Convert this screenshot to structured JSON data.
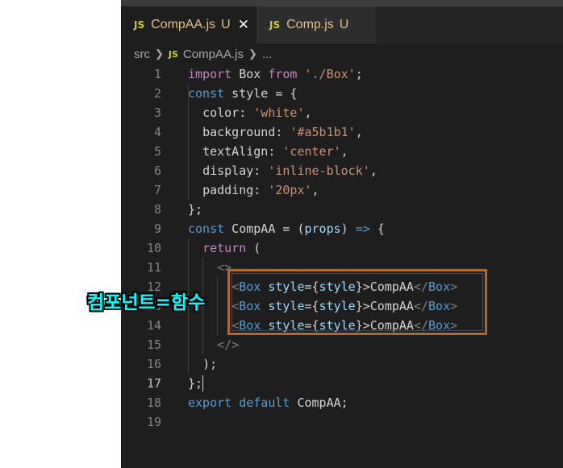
{
  "tabs": [
    {
      "icon": "JS",
      "name": "CompAA.js",
      "flag": "U",
      "close": "✕"
    },
    {
      "icon": "JS",
      "name": "Comp.js",
      "flag": "U"
    }
  ],
  "breadcrumb": {
    "folder": "src",
    "icon": "JS",
    "file": "CompAA.js",
    "more": "..."
  },
  "line_numbers": [
    "1",
    "2",
    "3",
    "4",
    "5",
    "6",
    "7",
    "8",
    "9",
    "10",
    "11",
    "12",
    "13",
    "14",
    "15",
    "16",
    "17",
    "18",
    "19"
  ],
  "code": {
    "l1": {
      "import": "import",
      "name": " Box ",
      "from": "from",
      "path": "'./Box'",
      "semi": ";"
    },
    "l2": {
      "const": "const",
      "rest": " style = {"
    },
    "l3": {
      "prop": "color",
      "colon": ": ",
      "val": "'white'",
      "comma": ","
    },
    "l4": {
      "prop": "background",
      "colon": ": ",
      "val": "'#a5b1b1'",
      "comma": ","
    },
    "l5": {
      "prop": "textAlign",
      "colon": ": ",
      "val": "'center'",
      "comma": ","
    },
    "l6": {
      "prop": "display",
      "colon": ": ",
      "val": "'inline-block'",
      "comma": ","
    },
    "l7": {
      "prop": "padding",
      "colon": ": ",
      "val": "'20px'",
      "comma": ","
    },
    "l8": {
      "text": "};"
    },
    "l9": {
      "const": "const",
      "name": " CompAA = (",
      "param": "props",
      "close": ") ",
      "arrow": "=>",
      "brace": " {"
    },
    "l10": {
      "kw": "return",
      "rest": " ("
    },
    "l11": {
      "frag": "<>"
    },
    "l12": {
      "open": "<",
      "tag": "Box",
      "attr": " style",
      "eq": "={",
      "expr": "style",
      "close1": "}>",
      "text": "CompAA",
      "open2": "</",
      "tag2": "Box",
      "close2": ">"
    },
    "l13": {
      "open": "<",
      "tag": "Box",
      "attr": " style",
      "eq": "={",
      "expr": "style",
      "close1": "}>",
      "text": "CompAA",
      "open2": "</",
      "tag2": "Box",
      "close2": ">"
    },
    "l14": {
      "open": "<",
      "tag": "Box",
      "attr": " style",
      "eq": "={",
      "expr": "style",
      "close1": "}>",
      "text": "CompAA",
      "open2": "</",
      "tag2": "Box",
      "close2": ">"
    },
    "l15": {
      "frag": "</>"
    },
    "l16": {
      "text": ");"
    },
    "l17": {
      "text": "};"
    },
    "l18": {
      "kw1": "export",
      "kw2": " default",
      "rest": " CompAA;"
    }
  },
  "annotation": "컴포넌트=함수",
  "colors": {
    "accent_box": "#b0692a",
    "annotation": "#00ffff"
  }
}
